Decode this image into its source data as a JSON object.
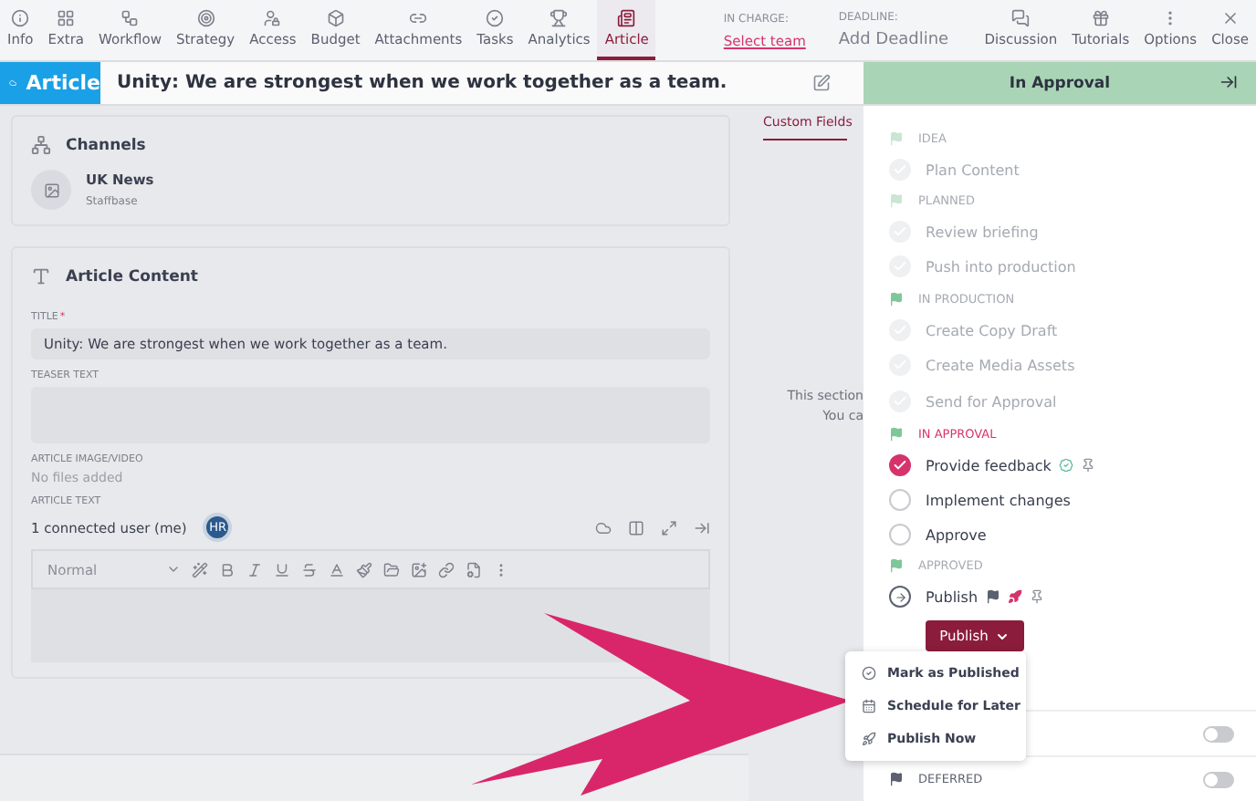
{
  "nav_tabs": [
    {
      "label": "Info",
      "selected": false
    },
    {
      "label": "Extra",
      "selected": false
    },
    {
      "label": "Workflow",
      "selected": false
    },
    {
      "label": "Strategy",
      "selected": false
    },
    {
      "label": "Access",
      "selected": false
    },
    {
      "label": "Budget",
      "selected": false
    },
    {
      "label": "Attachments",
      "selected": false
    },
    {
      "label": "Tasks",
      "selected": false
    },
    {
      "label": "Analytics",
      "selected": false
    },
    {
      "label": "Article",
      "selected": true
    }
  ],
  "in_charge": {
    "label": "IN CHARGE:",
    "value": "Select team"
  },
  "deadline": {
    "label": "DEADLINE:",
    "value": "Add Deadline"
  },
  "actions": [
    {
      "label": "Discussion"
    },
    {
      "label": "Tutorials"
    },
    {
      "label": "Options"
    },
    {
      "label": "Close"
    }
  ],
  "type_badge": "Article",
  "title": "Unity: We are strongest when we work together as a team.",
  "channels": {
    "heading": "Channels",
    "items": [
      {
        "name": "UK News",
        "source": "Staffbase"
      }
    ]
  },
  "article_content": {
    "heading": "Article Content",
    "title_label": "TITLE",
    "required_mark": "*",
    "title_value": "Unity: We are strongest when we work together as a team.",
    "teaser_label": "TEASER TEXT",
    "media_label": "ARTICLE IMAGE/VIDEO",
    "media_value": "No files added",
    "text_label": "ARTICLE TEXT",
    "connected": "1 connected user (me)",
    "avatar": "HR",
    "style_select": "Normal"
  },
  "side_tab": {
    "label": "Custom Fields",
    "selected": true
  },
  "side_note": [
    "This section",
    "You ca"
  ],
  "status_panel": {
    "title": "In Approval",
    "items": [
      {
        "kind": "stage",
        "label": "IDEA",
        "current": false,
        "faint": true
      },
      {
        "kind": "task",
        "label": "Plan Content",
        "done": true,
        "checked": false
      },
      {
        "kind": "stage",
        "label": "PLANNED",
        "current": false,
        "faint": true
      },
      {
        "kind": "task",
        "label": "Review briefing",
        "done": true,
        "checked": false
      },
      {
        "kind": "task",
        "label": "Push into production",
        "done": true,
        "checked": false
      },
      {
        "kind": "stage",
        "label": "IN PRODUCTION",
        "current": false,
        "faint": false
      },
      {
        "kind": "task",
        "label": "Create Copy Draft",
        "done": true,
        "checked": false
      },
      {
        "kind": "task",
        "label": "Create Media Assets",
        "done": true,
        "checked": false
      },
      {
        "kind": "task",
        "label": "Send for Approval",
        "done": true,
        "checked": false
      },
      {
        "kind": "stage",
        "label": "IN APPROVAL",
        "current": true,
        "faint": false
      },
      {
        "kind": "task",
        "label": "Provide feedback",
        "done": false,
        "checked": true
      },
      {
        "kind": "task",
        "label": "Implement changes",
        "done": false,
        "checked": false
      },
      {
        "kind": "task",
        "label": "Approve",
        "done": false,
        "checked": false
      },
      {
        "kind": "stage",
        "label": "APPROVED",
        "current": false,
        "faint": false
      },
      {
        "kind": "next",
        "label": "Publish"
      }
    ],
    "publish_button": "Publish",
    "toggles": [
      {
        "on": false
      },
      {
        "label": "DEFERRED",
        "on": false
      }
    ]
  },
  "publish_menu": [
    {
      "label": "Mark as Published"
    },
    {
      "label": "Schedule for Later"
    },
    {
      "label": "Publish Now"
    }
  ]
}
